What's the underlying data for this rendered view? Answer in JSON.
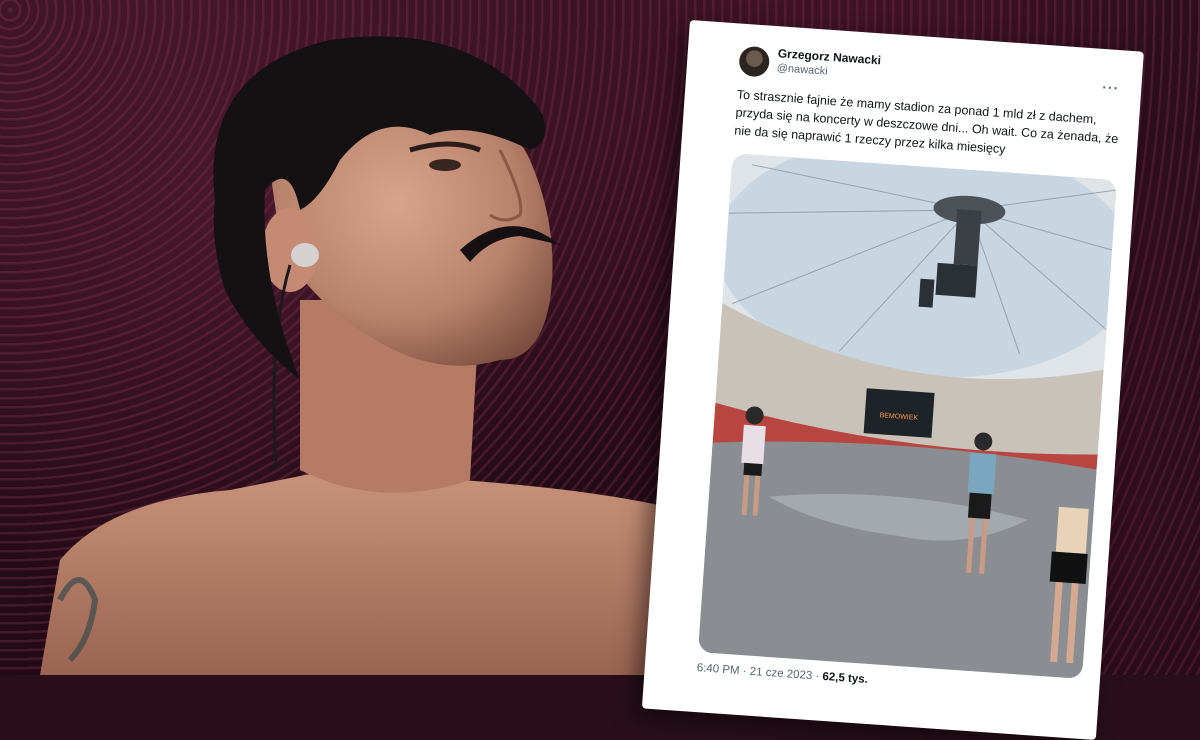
{
  "tweet": {
    "author_name": "Grzegorz Nawacki",
    "author_handle": "@nawacki",
    "more_icon": "more-horizontal-icon",
    "text": "To strasznie fajnie że mamy stadion za ponad 1 mld zł z dachem, przyda się na koncerty w deszczowe dni... Oh wait. Co za żenada, że nie da się naprawić 1 rzeczy przez kilka miesięcy",
    "photo_screen_text": "BEMOWIEK",
    "time": "6:40 PM",
    "date": "21 cze 2023",
    "views": "62,5 tys."
  },
  "colors": {
    "background": "#2a0f1a",
    "card": "#ffffff",
    "name": "#0f1419",
    "secondary": "#536471"
  }
}
